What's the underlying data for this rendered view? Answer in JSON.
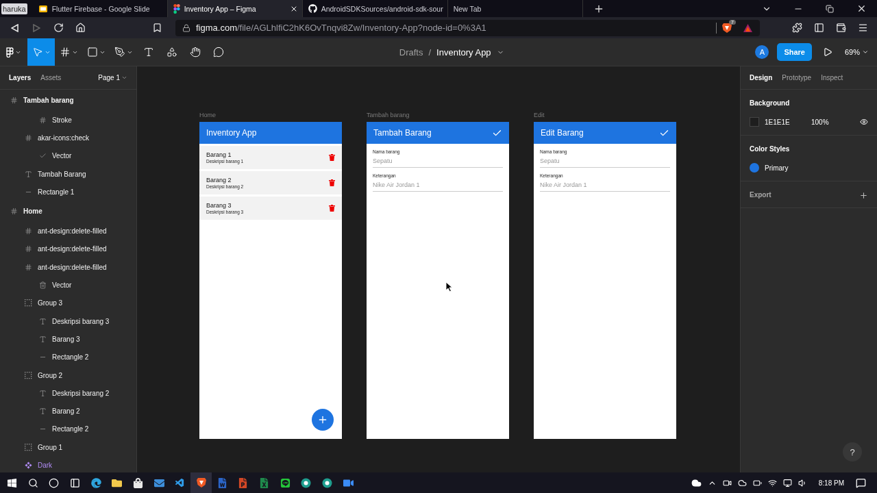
{
  "browser": {
    "profile": "haruka",
    "tabs": [
      {
        "title": "Flutter Firebase - Google Slide",
        "kind": "slides",
        "selected": false
      },
      {
        "title": "Inventory App – Figma",
        "kind": "figma",
        "selected": true
      },
      {
        "title": "AndroidSDKSources/android-sdk-sour",
        "kind": "github",
        "selected": false
      },
      {
        "title": "New Tab",
        "kind": "blank",
        "selected": false
      }
    ],
    "forward_disabled": true,
    "url_host": "figma.com",
    "url_path": "/file/AGLhlfiC2hK6OvTnqvi8Zw/Inventory-App?node-id=0%3A1",
    "shield_count": "7"
  },
  "toolbar": {
    "tools": [
      {
        "kind": "figma",
        "selected": false,
        "caret": true
      },
      {
        "kind": "move",
        "selected": true,
        "caret": true
      },
      {
        "kind": "frame",
        "selected": false,
        "caret": true
      },
      {
        "kind": "shape",
        "selected": false,
        "caret": true
      },
      {
        "kind": "pen",
        "selected": false,
        "caret": true
      },
      {
        "kind": "text",
        "selected": false,
        "caret": false
      },
      {
        "kind": "resources",
        "selected": false,
        "caret": false
      },
      {
        "kind": "hand",
        "selected": false,
        "caret": false
      },
      {
        "kind": "comment",
        "selected": false,
        "caret": false
      }
    ],
    "breadcrumb": {
      "parent": "Drafts",
      "separator": "/",
      "file": "Inventory App"
    },
    "avatar": "A",
    "share": "Share",
    "zoom": "69%"
  },
  "left_panel": {
    "tabs": [
      {
        "label": "Layers",
        "selected": true
      },
      {
        "label": "Assets",
        "selected": false
      }
    ],
    "page": "Page 1",
    "layers": [
      {
        "name": "Tambah barang",
        "kind": "frame",
        "children": [
          {
            "children": [
              {
                "name": "Stroke",
                "kind": "frame"
              }
            ]
          },
          {
            "name": "akar-icons:check",
            "kind": "frame",
            "children": [
              {
                "name": "Vector",
                "kind": "check"
              }
            ]
          },
          {
            "name": "Tambah Barang",
            "kind": "text"
          },
          {
            "name": "Rectangle 1",
            "kind": "line"
          }
        ]
      },
      {
        "name": "Home",
        "kind": "frame",
        "children": [
          {
            "name": "ant-design:delete-filled",
            "kind": "frame"
          },
          {
            "name": "ant-design:delete-filled",
            "kind": "frame"
          },
          {
            "name": "ant-design:delete-filled",
            "kind": "frame",
            "children": [
              {
                "name": "Vector",
                "kind": "trash"
              }
            ]
          },
          {
            "name": "Group 3",
            "kind": "group",
            "children": [
              {
                "name": "Deskripsi barang 3",
                "kind": "text"
              },
              {
                "name": "Barang 3",
                "kind": "text"
              },
              {
                "name": "Rectangle 2",
                "kind": "line"
              }
            ]
          },
          {
            "name": "Group 2",
            "kind": "group",
            "children": [
              {
                "name": "Deskripsi barang 2",
                "kind": "text"
              },
              {
                "name": "Barang 2",
                "kind": "text"
              },
              {
                "name": "Rectangle 2",
                "kind": "line"
              }
            ]
          },
          {
            "name": "Group 1",
            "kind": "group"
          },
          {
            "name": "Dark",
            "kind": "component"
          }
        ]
      }
    ]
  },
  "canvas": {
    "frames": [
      {
        "label": "Home",
        "kind": "list",
        "title": "Inventory App",
        "items": [
          {
            "title": "Barang 1",
            "subtitle": "Deskripsi barang 1"
          },
          {
            "title": "Barang 2",
            "subtitle": "Deskripsi barang 2"
          },
          {
            "title": "Barang 3",
            "subtitle": "Deskripsi barang 3"
          }
        ]
      },
      {
        "label": "Tambah barang",
        "kind": "form",
        "title": "Tambah Barang",
        "fields": [
          {
            "label": "Nama barang",
            "placeholder": "Sepatu"
          },
          {
            "label": "Keterangan",
            "placeholder": "Nike Air Jordan 1"
          }
        ]
      },
      {
        "label": "Edit",
        "kind": "form",
        "title": "Edit Barang",
        "fields": [
          {
            "label": "Nama barang",
            "placeholder": "Sepatu"
          },
          {
            "label": "Keterangan",
            "placeholder": "Nike Air Jordan 1"
          }
        ]
      }
    ]
  },
  "right_panel": {
    "tabs": [
      {
        "label": "Design",
        "selected": true
      },
      {
        "label": "Prototype",
        "selected": false
      },
      {
        "label": "Inspect",
        "selected": false
      }
    ],
    "background": {
      "title": "Background",
      "hex": "1E1E1E",
      "opacity": "100%"
    },
    "color_styles": {
      "title": "Color Styles",
      "items": [
        {
          "name": "Primary",
          "color": "#1e74e0"
        }
      ]
    },
    "export": {
      "title": "Export"
    }
  },
  "help": "?",
  "taskbar": {
    "apps": [
      {
        "kind": "edge",
        "selected": false
      },
      {
        "kind": "files",
        "selected": false
      },
      {
        "kind": "store",
        "selected": false
      },
      {
        "kind": "mail",
        "selected": false
      },
      {
        "kind": "vscode",
        "selected": false
      },
      {
        "kind": "brave",
        "selected": true
      },
      {
        "kind": "word",
        "selected": false
      },
      {
        "kind": "powerpoint",
        "selected": false
      },
      {
        "kind": "excel",
        "selected": false
      },
      {
        "kind": "line",
        "selected": false
      },
      {
        "kind": "app",
        "selected": false
      },
      {
        "kind": "app",
        "selected": false
      },
      {
        "kind": "zoom",
        "selected": false
      }
    ],
    "time": "8:18 PM"
  }
}
